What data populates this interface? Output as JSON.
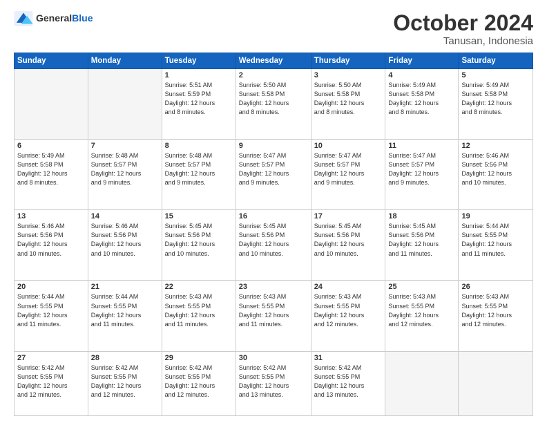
{
  "header": {
    "logo_general": "General",
    "logo_blue": "Blue",
    "month": "October 2024",
    "location": "Tanusan, Indonesia"
  },
  "weekdays": [
    "Sunday",
    "Monday",
    "Tuesday",
    "Wednesday",
    "Thursday",
    "Friday",
    "Saturday"
  ],
  "weeks": [
    [
      {
        "day": "",
        "info": ""
      },
      {
        "day": "",
        "info": ""
      },
      {
        "day": "1",
        "info": "Sunrise: 5:51 AM\nSunset: 5:59 PM\nDaylight: 12 hours\nand 8 minutes."
      },
      {
        "day": "2",
        "info": "Sunrise: 5:50 AM\nSunset: 5:58 PM\nDaylight: 12 hours\nand 8 minutes."
      },
      {
        "day": "3",
        "info": "Sunrise: 5:50 AM\nSunset: 5:58 PM\nDaylight: 12 hours\nand 8 minutes."
      },
      {
        "day": "4",
        "info": "Sunrise: 5:49 AM\nSunset: 5:58 PM\nDaylight: 12 hours\nand 8 minutes."
      },
      {
        "day": "5",
        "info": "Sunrise: 5:49 AM\nSunset: 5:58 PM\nDaylight: 12 hours\nand 8 minutes."
      }
    ],
    [
      {
        "day": "6",
        "info": "Sunrise: 5:49 AM\nSunset: 5:58 PM\nDaylight: 12 hours\nand 8 minutes."
      },
      {
        "day": "7",
        "info": "Sunrise: 5:48 AM\nSunset: 5:57 PM\nDaylight: 12 hours\nand 9 minutes."
      },
      {
        "day": "8",
        "info": "Sunrise: 5:48 AM\nSunset: 5:57 PM\nDaylight: 12 hours\nand 9 minutes."
      },
      {
        "day": "9",
        "info": "Sunrise: 5:47 AM\nSunset: 5:57 PM\nDaylight: 12 hours\nand 9 minutes."
      },
      {
        "day": "10",
        "info": "Sunrise: 5:47 AM\nSunset: 5:57 PM\nDaylight: 12 hours\nand 9 minutes."
      },
      {
        "day": "11",
        "info": "Sunrise: 5:47 AM\nSunset: 5:57 PM\nDaylight: 12 hours\nand 9 minutes."
      },
      {
        "day": "12",
        "info": "Sunrise: 5:46 AM\nSunset: 5:56 PM\nDaylight: 12 hours\nand 10 minutes."
      }
    ],
    [
      {
        "day": "13",
        "info": "Sunrise: 5:46 AM\nSunset: 5:56 PM\nDaylight: 12 hours\nand 10 minutes."
      },
      {
        "day": "14",
        "info": "Sunrise: 5:46 AM\nSunset: 5:56 PM\nDaylight: 12 hours\nand 10 minutes."
      },
      {
        "day": "15",
        "info": "Sunrise: 5:45 AM\nSunset: 5:56 PM\nDaylight: 12 hours\nand 10 minutes."
      },
      {
        "day": "16",
        "info": "Sunrise: 5:45 AM\nSunset: 5:56 PM\nDaylight: 12 hours\nand 10 minutes."
      },
      {
        "day": "17",
        "info": "Sunrise: 5:45 AM\nSunset: 5:56 PM\nDaylight: 12 hours\nand 10 minutes."
      },
      {
        "day": "18",
        "info": "Sunrise: 5:45 AM\nSunset: 5:56 PM\nDaylight: 12 hours\nand 11 minutes."
      },
      {
        "day": "19",
        "info": "Sunrise: 5:44 AM\nSunset: 5:55 PM\nDaylight: 12 hours\nand 11 minutes."
      }
    ],
    [
      {
        "day": "20",
        "info": "Sunrise: 5:44 AM\nSunset: 5:55 PM\nDaylight: 12 hours\nand 11 minutes."
      },
      {
        "day": "21",
        "info": "Sunrise: 5:44 AM\nSunset: 5:55 PM\nDaylight: 12 hours\nand 11 minutes."
      },
      {
        "day": "22",
        "info": "Sunrise: 5:43 AM\nSunset: 5:55 PM\nDaylight: 12 hours\nand 11 minutes."
      },
      {
        "day": "23",
        "info": "Sunrise: 5:43 AM\nSunset: 5:55 PM\nDaylight: 12 hours\nand 11 minutes."
      },
      {
        "day": "24",
        "info": "Sunrise: 5:43 AM\nSunset: 5:55 PM\nDaylight: 12 hours\nand 12 minutes."
      },
      {
        "day": "25",
        "info": "Sunrise: 5:43 AM\nSunset: 5:55 PM\nDaylight: 12 hours\nand 12 minutes."
      },
      {
        "day": "26",
        "info": "Sunrise: 5:43 AM\nSunset: 5:55 PM\nDaylight: 12 hours\nand 12 minutes."
      }
    ],
    [
      {
        "day": "27",
        "info": "Sunrise: 5:42 AM\nSunset: 5:55 PM\nDaylight: 12 hours\nand 12 minutes."
      },
      {
        "day": "28",
        "info": "Sunrise: 5:42 AM\nSunset: 5:55 PM\nDaylight: 12 hours\nand 12 minutes."
      },
      {
        "day": "29",
        "info": "Sunrise: 5:42 AM\nSunset: 5:55 PM\nDaylight: 12 hours\nand 12 minutes."
      },
      {
        "day": "30",
        "info": "Sunrise: 5:42 AM\nSunset: 5:55 PM\nDaylight: 12 hours\nand 13 minutes."
      },
      {
        "day": "31",
        "info": "Sunrise: 5:42 AM\nSunset: 5:55 PM\nDaylight: 12 hours\nand 13 minutes."
      },
      {
        "day": "",
        "info": ""
      },
      {
        "day": "",
        "info": ""
      }
    ]
  ]
}
